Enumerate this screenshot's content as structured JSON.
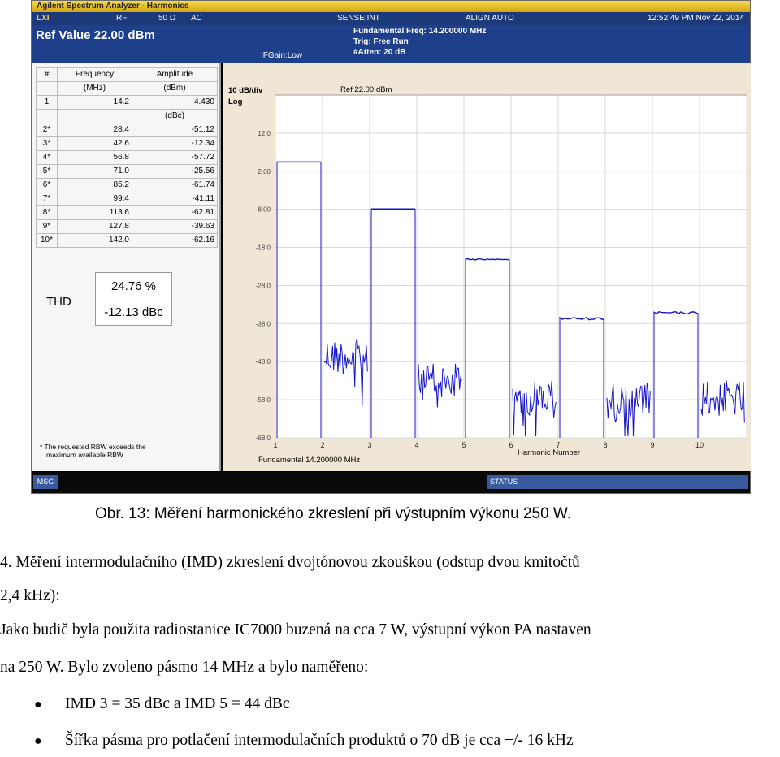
{
  "analyzer": {
    "title": "Agilent Spectrum Analyzer - Harmonics",
    "status": {
      "logo": "LXI",
      "rf": "RF",
      "ohm": "50 Ω",
      "ac": "AC",
      "sense": "SENSE:INT",
      "align": "ALIGN AUTO",
      "time": "12:52:49 PM Nov 22, 2014"
    },
    "ref_value": "Ref Value 22.00 dBm",
    "fundamental_freq": "Fundamental Freq: 14.200000 MHz",
    "trig": "Trig: Free Run",
    "atten": "#Atten: 20 dB",
    "ifgain": "IFGain:Low",
    "table": {
      "headers": [
        "#",
        "Frequency",
        "Amplitude"
      ],
      "units1": [
        "",
        "(MHz)",
        "(dBm)"
      ],
      "first_row": [
        "1",
        "14.2",
        "4.430"
      ],
      "unit_dbc": "(dBc)",
      "rows": [
        [
          "2*",
          "28.4",
          "-51.12"
        ],
        [
          "3*",
          "42.6",
          "-12.34"
        ],
        [
          "4*",
          "56.8",
          "-57.72"
        ],
        [
          "5*",
          "71.0",
          "-25.56"
        ],
        [
          "6*",
          "85.2",
          "-61.74"
        ],
        [
          "7*",
          "99.4",
          "-41.11"
        ],
        [
          "8*",
          "113.6",
          "-62.81"
        ],
        [
          "9*",
          "127.8",
          "-39.63"
        ],
        [
          "10*",
          "142.0",
          "-62.16"
        ]
      ]
    },
    "thd_label": "THD",
    "thd_percent": "24.76 %",
    "thd_dbc": "-12.13 dBc",
    "note_line1": "* The requested RBW exceeds the",
    "note_line2": "maximum available RBW",
    "plot": {
      "scale": "10 dB/div",
      "scale_type": "Log",
      "ref": "Ref 22.00 dBm",
      "xlabel": "Harmonic Number",
      "fundamental": "Fundamental  14.200000 MHz",
      "trace_color": "#1515c8"
    },
    "msg_label": "MSG",
    "status_label": "STATUS"
  },
  "chart_data": {
    "type": "bar",
    "categories": [
      "1",
      "2",
      "3",
      "4",
      "5",
      "6",
      "7",
      "8",
      "9",
      "10"
    ],
    "values": [
      4.43,
      -46.69,
      -7.91,
      -53.29,
      -21.13,
      -57.31,
      -36.68,
      -58.38,
      -35.2,
      -57.73
    ],
    "ylim": [
      -68,
      22
    ],
    "yticks": [
      "12.0",
      "2.00",
      "-8.00",
      "-18.0",
      "-28.0",
      "-38.0",
      "-48.0",
      "-58.0",
      "-68.0"
    ],
    "xlabel": "Harmonic Number",
    "ylabel": "",
    "title": ""
  },
  "document": {
    "caption": "Obr. 13: Měření harmonického zkreslení při výstupním výkonu 250 W.",
    "para1_line1": "4. Měření intermodulačního (IMD) zkreslení dvojtónovou zkouškou (odstup dvou kmitočtů",
    "para1_line2": "2,4 kHz):",
    "para2_line1": "Jako budič byla použita radiostanice IC7000 buzená na cca 7 W, výstupní výkon PA nastaven",
    "para2_line2": "na 250 W. Bylo zvoleno pásmo 14 MHz a bylo naměřeno:",
    "bullets": [
      "IMD 3 = 35 dBc a IMD 5 = 44 dBc",
      "Šířka pásma pro potlačení intermodulačních produktů o 70 dB je cca +/- 16 kHz"
    ]
  }
}
